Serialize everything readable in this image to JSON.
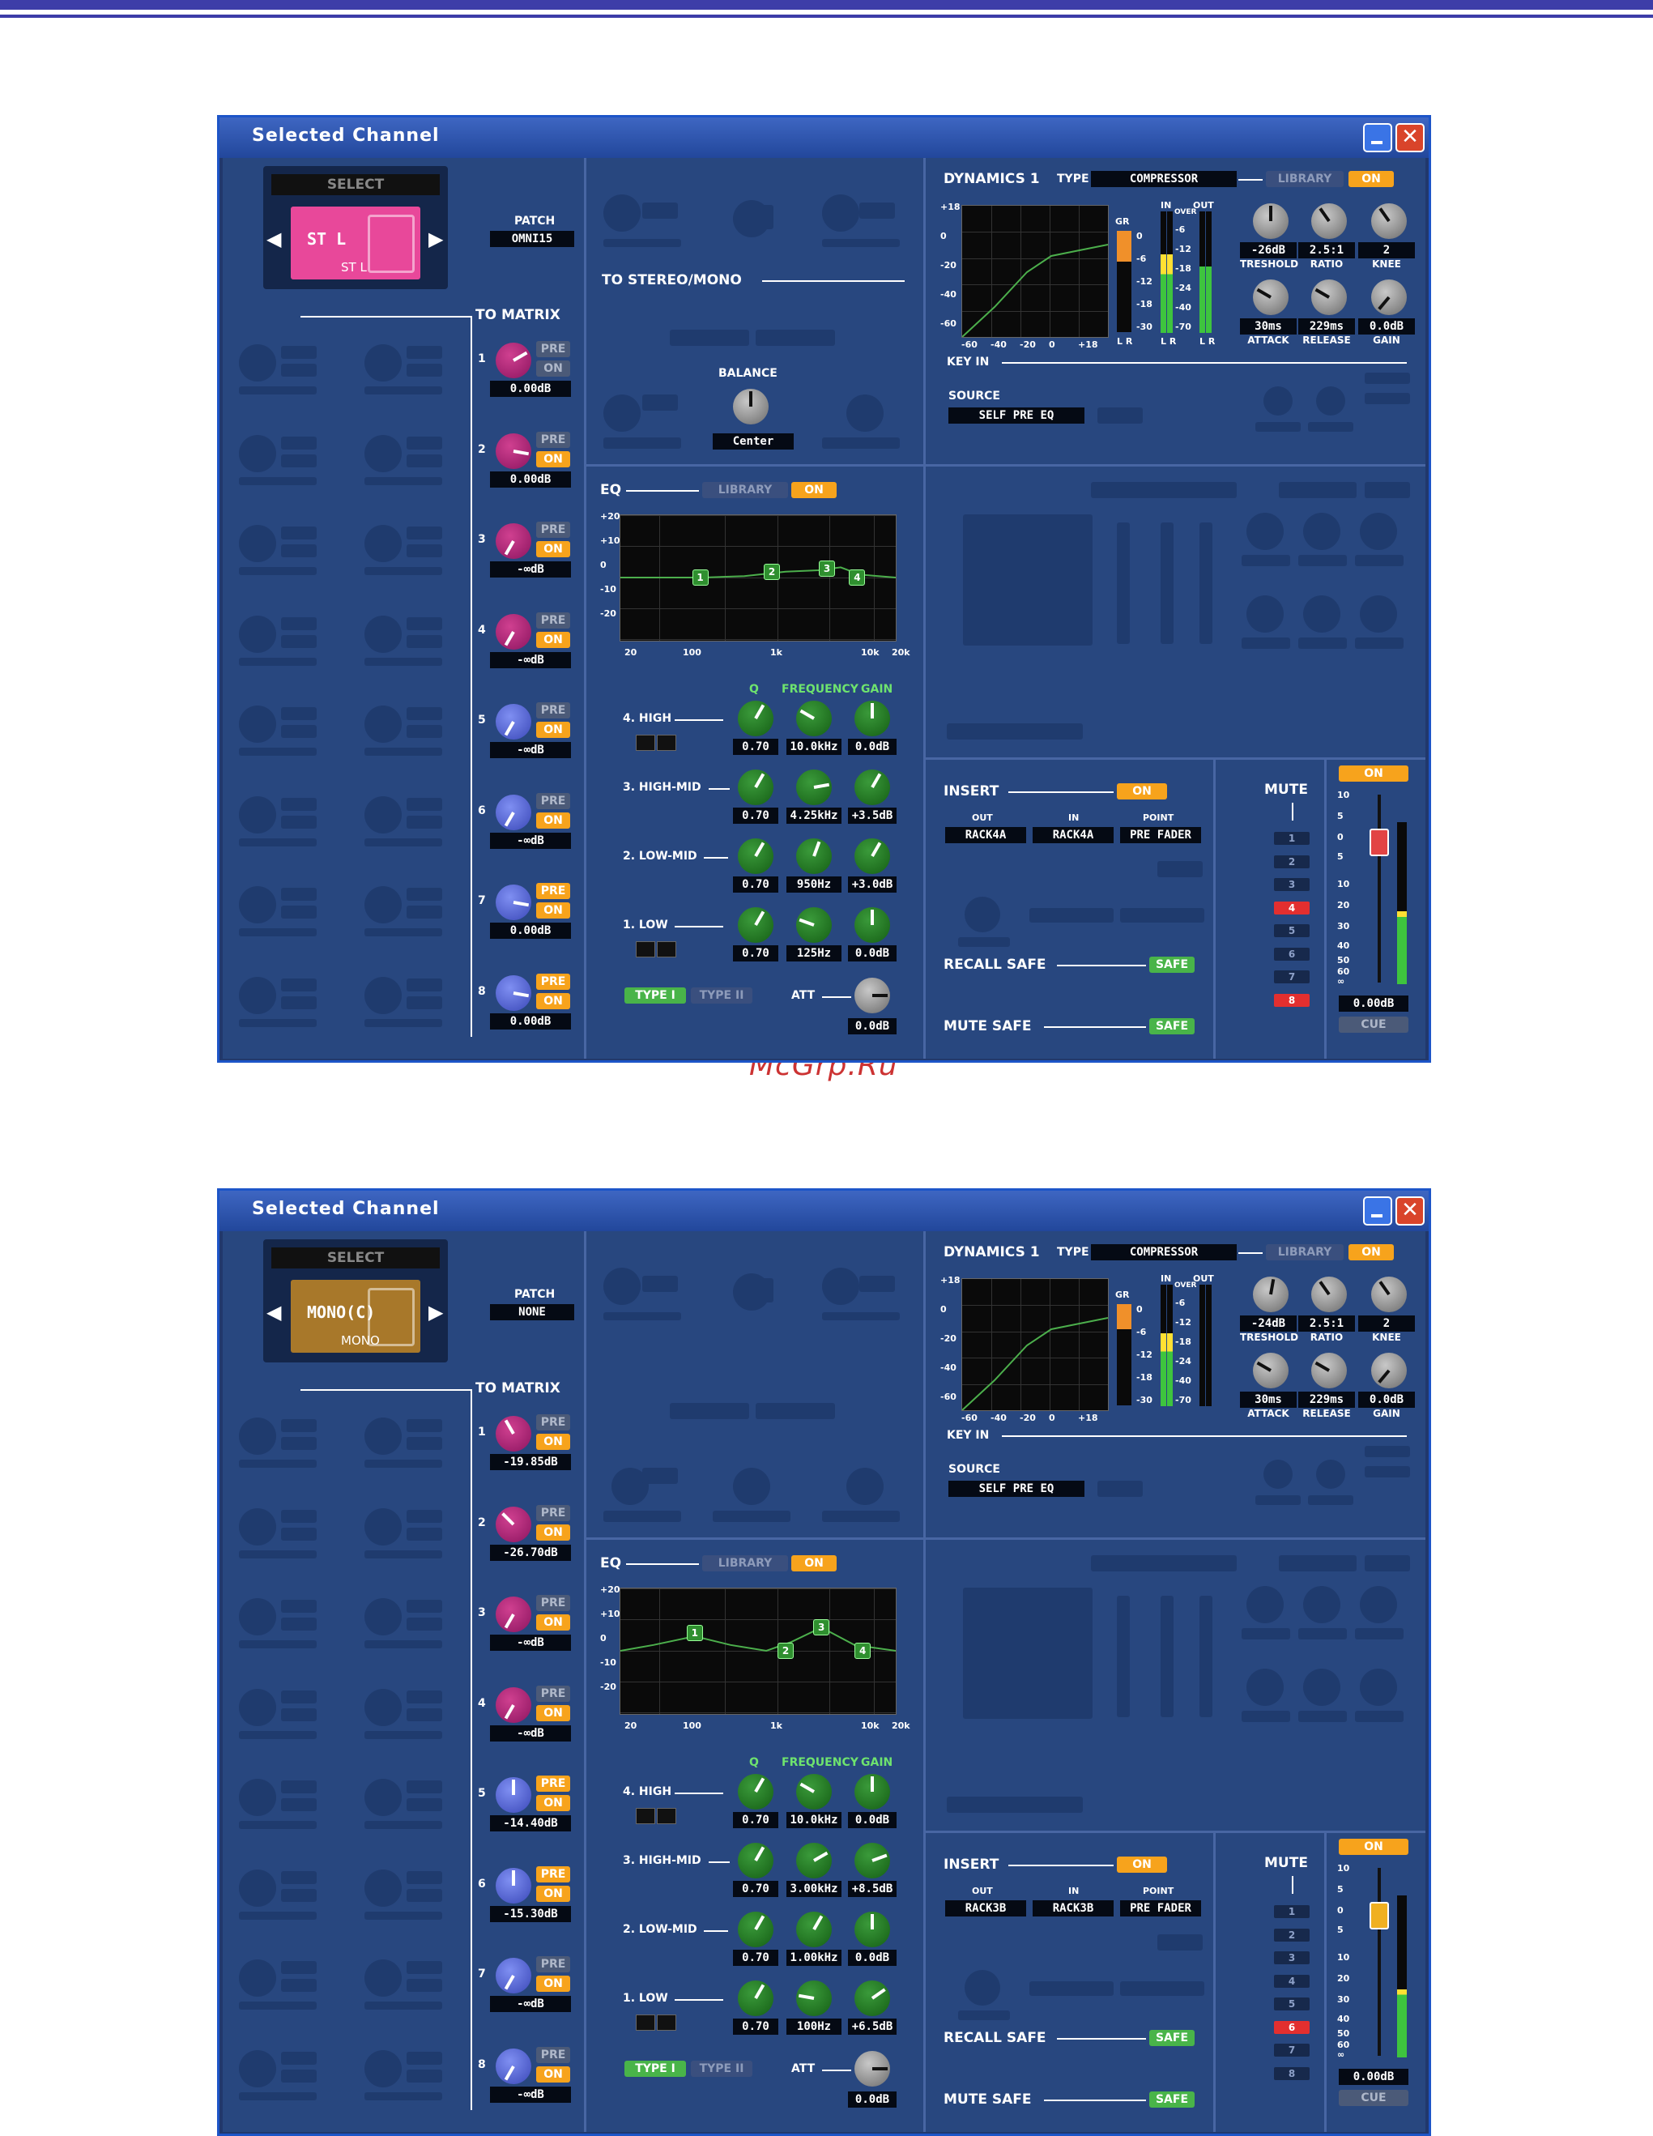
{
  "watermark": "McGrp.Ru",
  "windows": [
    {
      "title": "Selected Channel",
      "select_label": "SELECT",
      "channel_name": "ST L",
      "channel_sub": "ST L",
      "channel_color": "#e8489a",
      "patch_label": "PATCH",
      "patch_value": "OMNI15",
      "to_matrix": "TO MATRIX",
      "to_stereo_mono": "TO STEREO/MONO",
      "balance_label": "BALANCE",
      "balance_value": "Center",
      "matrix": [
        {
          "num": "1",
          "pre": "PRE",
          "on": "ON",
          "pre_on": false,
          "on_on": false,
          "value": "0.00dB",
          "color": "mag",
          "angle": 60
        },
        {
          "num": "2",
          "pre": "PRE",
          "on": "ON",
          "pre_on": false,
          "on_on": true,
          "value": "0.00dB",
          "color": "mag",
          "angle": 100
        },
        {
          "num": "3",
          "pre": "PRE",
          "on": "ON",
          "pre_on": false,
          "on_on": true,
          "value": "-∞dB",
          "color": "mag",
          "angle": -150
        },
        {
          "num": "4",
          "pre": "PRE",
          "on": "ON",
          "pre_on": false,
          "on_on": true,
          "value": "-∞dB",
          "color": "mag",
          "angle": -150
        },
        {
          "num": "5",
          "pre": "PRE",
          "on": "ON",
          "pre_on": false,
          "on_on": true,
          "value": "-∞dB",
          "color": "blu",
          "angle": -150
        },
        {
          "num": "6",
          "pre": "PRE",
          "on": "ON",
          "pre_on": false,
          "on_on": true,
          "value": "-∞dB",
          "color": "blu",
          "angle": -150
        },
        {
          "num": "7",
          "pre": "PRE",
          "on": "ON",
          "pre_on": true,
          "on_on": true,
          "value": "0.00dB",
          "color": "blu",
          "angle": 100
        },
        {
          "num": "8",
          "pre": "PRE",
          "on": "ON",
          "pre_on": true,
          "on_on": true,
          "value": "0.00dB",
          "color": "blu",
          "angle": 100
        }
      ],
      "eq": {
        "label": "EQ",
        "library": "LIBRARY",
        "on": "ON",
        "y_ticks": [
          "+20",
          "+10",
          "0",
          "-10",
          "-20"
        ],
        "x_ticks": [
          "20",
          "100",
          "1k",
          "10k",
          "20k"
        ],
        "col_q": "Q",
        "col_freq": "FREQUENCY",
        "col_gain": "GAIN",
        "curve": [
          [
            0,
            0
          ],
          [
            0.3,
            0
          ],
          [
            0.45,
            0.5
          ],
          [
            0.6,
            2
          ],
          [
            0.72,
            2.5
          ],
          [
            0.8,
            3.5
          ],
          [
            0.87,
            1
          ],
          [
            1,
            0
          ]
        ],
        "points": [
          {
            "n": "1",
            "x": 0.29,
            "y": 0
          },
          {
            "n": "2",
            "x": 0.55,
            "y": 2
          },
          {
            "n": "3",
            "x": 0.75,
            "y": 3
          },
          {
            "n": "4",
            "x": 0.86,
            "y": 0
          }
        ],
        "bands": [
          {
            "name": "4. HIGH",
            "q": "0.70",
            "freq": "10.0kHz",
            "gain": "0.0dB",
            "qa": 30,
            "fa": -60,
            "ga": 0
          },
          {
            "name": "3. HIGH-MID",
            "q": "0.70",
            "freq": "4.25kHz",
            "gain": "+3.5dB",
            "qa": 30,
            "fa": 80,
            "ga": 30
          },
          {
            "name": "2. LOW-MID",
            "q": "0.70",
            "freq": "950Hz",
            "gain": "+3.0dB",
            "qa": 30,
            "fa": 20,
            "ga": 30
          },
          {
            "name": "1. LOW",
            "q": "0.70",
            "freq": "125Hz",
            "gain": "0.0dB",
            "qa": 30,
            "fa": -70,
            "ga": 0
          }
        ],
        "type1": "TYPE I",
        "type2": "TYPE II",
        "att_label": "ATT",
        "att_value": "0.0dB"
      },
      "dynamics": {
        "label": "DYNAMICS 1",
        "type_label": "TYPE",
        "type_value": "COMPRESSOR",
        "library": "LIBRARY",
        "on": "ON",
        "y_ticks": [
          "+18",
          "0",
          "-20",
          "-40",
          "-60"
        ],
        "x_ticks": [
          "-60",
          "-40",
          "-20",
          "0",
          "+18"
        ],
        "gr_label": "GR",
        "gr_ticks": [
          "0",
          "-6",
          "-12",
          "-18",
          "-30"
        ],
        "in_label": "IN",
        "out_label": "OUT",
        "over_label": "OVER",
        "io_ticks": [
          "-6",
          "-12",
          "-18",
          "-24",
          "-40",
          "-70"
        ],
        "lr": "L R",
        "params": [
          {
            "name": "TRESHOLD",
            "value": "-26dB",
            "angle": 0
          },
          {
            "name": "RATIO",
            "value": "2.5:1",
            "angle": -35
          },
          {
            "name": "KNEE",
            "value": "2",
            "angle": -35
          },
          {
            "name": "ATTACK",
            "value": "30ms",
            "angle": -60
          },
          {
            "name": "RELEASE",
            "value": "229ms",
            "angle": -60
          },
          {
            "name": "GAIN",
            "value": "0.0dB",
            "angle": -140
          }
        ],
        "key_in": "KEY IN",
        "source_label": "SOURCE",
        "source_value": "SELF PRE EQ",
        "gr_level": 0.3,
        "in_level": 0.65,
        "out_level": 0.55
      },
      "insert": {
        "label": "INSERT",
        "on": "ON",
        "out_label": "OUT",
        "in_label": "IN",
        "point_label": "POINT",
        "out_value": "RACK4A",
        "in_value": "RACK4A",
        "point_value": "PRE FADER"
      },
      "recall_safe": "RECALL SAFE",
      "mute_safe": "MUTE SAFE",
      "safe": "SAFE",
      "mute_label": "MUTE",
      "mutes": [
        {
          "n": "1",
          "on": false
        },
        {
          "n": "2",
          "on": false
        },
        {
          "n": "3",
          "on": false
        },
        {
          "n": "4",
          "on": true
        },
        {
          "n": "5",
          "on": false
        },
        {
          "n": "6",
          "on": false
        },
        {
          "n": "7",
          "on": false
        },
        {
          "n": "8",
          "on": true
        }
      ],
      "fader": {
        "on": "ON",
        "ticks": [
          "10",
          "5",
          "0",
          "5",
          "10",
          "20",
          "30",
          "40",
          "50",
          "60",
          "∞"
        ],
        "value": "0.00dB",
        "cue": "CUE",
        "knob_color": "#e24444",
        "level": 0.45
      }
    },
    {
      "title": "Selected Channel",
      "select_label": "SELECT",
      "channel_name": "MONO(C)",
      "channel_sub": "MONO",
      "channel_color": "#a8782a",
      "patch_label": "PATCH",
      "patch_value": "NONE",
      "to_matrix": "TO MATRIX",
      "matrix": [
        {
          "num": "1",
          "pre": "PRE",
          "on": "ON",
          "pre_on": false,
          "on_on": true,
          "value": "-19.85dB",
          "color": "mag",
          "angle": -30
        },
        {
          "num": "2",
          "pre": "PRE",
          "on": "ON",
          "pre_on": false,
          "on_on": true,
          "value": "-26.70dB",
          "color": "mag",
          "angle": -45
        },
        {
          "num": "3",
          "pre": "PRE",
          "on": "ON",
          "pre_on": false,
          "on_on": true,
          "value": "-∞dB",
          "color": "mag",
          "angle": -150
        },
        {
          "num": "4",
          "pre": "PRE",
          "on": "ON",
          "pre_on": false,
          "on_on": true,
          "value": "-∞dB",
          "color": "mag",
          "angle": -150
        },
        {
          "num": "5",
          "pre": "PRE",
          "on": "ON",
          "pre_on": true,
          "on_on": true,
          "value": "-14.40dB",
          "color": "blu",
          "angle": 0
        },
        {
          "num": "6",
          "pre": "PRE",
          "on": "ON",
          "pre_on": true,
          "on_on": true,
          "value": "-15.30dB",
          "color": "blu",
          "angle": 0
        },
        {
          "num": "7",
          "pre": "PRE",
          "on": "ON",
          "pre_on": false,
          "on_on": true,
          "value": "-∞dB",
          "color": "blu",
          "angle": -150
        },
        {
          "num": "8",
          "pre": "PRE",
          "on": "ON",
          "pre_on": false,
          "on_on": true,
          "value": "-∞dB",
          "color": "blu",
          "angle": -150
        }
      ],
      "eq": {
        "label": "EQ",
        "library": "LIBRARY",
        "on": "ON",
        "y_ticks": [
          "+20",
          "+10",
          "0",
          "-10",
          "-20"
        ],
        "x_ticks": [
          "20",
          "100",
          "1k",
          "10k",
          "20k"
        ],
        "col_q": "Q",
        "col_freq": "FREQUENCY",
        "col_gain": "GAIN",
        "curve": [
          [
            0,
            0
          ],
          [
            0.12,
            2
          ],
          [
            0.27,
            5
          ],
          [
            0.4,
            2
          ],
          [
            0.53,
            0
          ],
          [
            0.62,
            3
          ],
          [
            0.73,
            8
          ],
          [
            0.85,
            2
          ],
          [
            1,
            0
          ]
        ],
        "points": [
          {
            "n": "1",
            "x": 0.27,
            "y": 6
          },
          {
            "n": "2",
            "x": 0.6,
            "y": 0
          },
          {
            "n": "3",
            "x": 0.73,
            "y": 8
          },
          {
            "n": "4",
            "x": 0.88,
            "y": 0
          }
        ],
        "bands": [
          {
            "name": "4. HIGH",
            "q": "0.70",
            "freq": "10.0kHz",
            "gain": "0.0dB",
            "qa": 30,
            "fa": -60,
            "ga": 0
          },
          {
            "name": "3. HIGH-MID",
            "q": "0.70",
            "freq": "3.00kHz",
            "gain": "+8.5dB",
            "qa": 30,
            "fa": 60,
            "ga": 70
          },
          {
            "name": "2. LOW-MID",
            "q": "0.70",
            "freq": "1.00kHz",
            "gain": "0.0dB",
            "qa": 30,
            "fa": 30,
            "ga": 0
          },
          {
            "name": "1. LOW",
            "q": "0.70",
            "freq": "100Hz",
            "gain": "+6.5dB",
            "qa": 30,
            "fa": -80,
            "ga": 55
          }
        ],
        "type1": "TYPE I",
        "type2": "TYPE II",
        "att_label": "ATT",
        "att_value": "0.0dB"
      },
      "dynamics": {
        "label": "DYNAMICS 1",
        "type_label": "TYPE",
        "type_value": "COMPRESSOR",
        "library": "LIBRARY",
        "on": "ON",
        "y_ticks": [
          "+18",
          "0",
          "-20",
          "-40",
          "-60"
        ],
        "x_ticks": [
          "-60",
          "-40",
          "-20",
          "0",
          "+18"
        ],
        "gr_label": "GR",
        "gr_ticks": [
          "0",
          "-6",
          "-12",
          "-18",
          "-30"
        ],
        "in_label": "IN",
        "out_label": "OUT",
        "over_label": "OVER",
        "io_ticks": [
          "-6",
          "-12",
          "-18",
          "-24",
          "-40",
          "-70"
        ],
        "params": [
          {
            "name": "TRESHOLD",
            "value": "-24dB",
            "angle": 10
          },
          {
            "name": "RATIO",
            "value": "2.5:1",
            "angle": -35
          },
          {
            "name": "KNEE",
            "value": "2",
            "angle": -35
          },
          {
            "name": "ATTACK",
            "value": "30ms",
            "angle": -60
          },
          {
            "name": "RELEASE",
            "value": "229ms",
            "angle": -60
          },
          {
            "name": "GAIN",
            "value": "0.0dB",
            "angle": -140
          }
        ],
        "key_in": "KEY IN",
        "source_label": "SOURCE",
        "source_value": "SELF PRE EQ",
        "gr_level": 0.25,
        "in_level": 0.6,
        "out_level": 0.0
      },
      "insert": {
        "label": "INSERT",
        "on": "ON",
        "out_label": "OUT",
        "in_label": "IN",
        "point_label": "POINT",
        "out_value": "RACK3B",
        "in_value": "RACK3B",
        "point_value": "PRE FADER"
      },
      "recall_safe": "RECALL SAFE",
      "mute_safe": "MUTE SAFE",
      "safe": "SAFE",
      "mute_label": "MUTE",
      "mutes": [
        {
          "n": "1",
          "on": false
        },
        {
          "n": "2",
          "on": false
        },
        {
          "n": "3",
          "on": false
        },
        {
          "n": "4",
          "on": false
        },
        {
          "n": "5",
          "on": false
        },
        {
          "n": "6",
          "on": true
        },
        {
          "n": "7",
          "on": false
        },
        {
          "n": "8",
          "on": false
        }
      ],
      "fader": {
        "on": "ON",
        "ticks": [
          "10",
          "5",
          "0",
          "5",
          "10",
          "20",
          "30",
          "40",
          "50",
          "60",
          "∞"
        ],
        "value": "0.00dB",
        "cue": "CUE",
        "knob_color": "#f0b020",
        "level": 0.42
      }
    }
  ]
}
